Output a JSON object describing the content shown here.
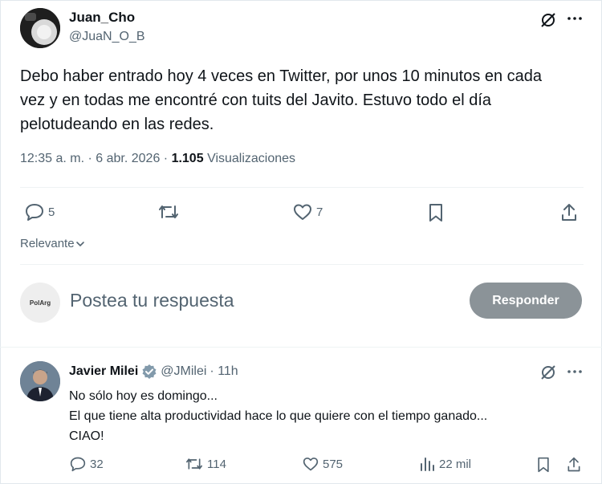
{
  "main_tweet": {
    "display_name": "Juan_Cho",
    "handle": "@JuaN_O_B",
    "text_line1": "Debo haber entrado hoy 4 veces en Twitter, por unos 10 minutos en cada",
    "text_line2": "vez y en todas me encontré con tuits del Javito. Estuvo todo el día",
    "text_line3": "pelotudeando en las redes.",
    "timestamp": "12:35 a. m. · 6 abr. 2026 · ",
    "views_count": "1.105",
    "views_label": "Visualizaciones",
    "replies": "5",
    "likes": "7"
  },
  "sort": {
    "label": "Relevante"
  },
  "composer": {
    "avatar_text": "PolArg",
    "placeholder": "Postea tu respuesta",
    "reply_button": "Responder"
  },
  "reply_tweet": {
    "display_name": "Javier Milei",
    "handle": "@JMilei",
    "time": "· 11h",
    "text_line1": "No sólo hoy es domingo...",
    "text_line2": "El que tiene alta productividad hace lo que quiere con el tiempo ganado...",
    "text_line3": "CIAO!",
    "replies": "32",
    "retweets": "114",
    "likes": "575",
    "views": "22 mil"
  },
  "colors": {
    "verified": "#829aab",
    "muted": "#536471",
    "button": "#8b9398"
  }
}
